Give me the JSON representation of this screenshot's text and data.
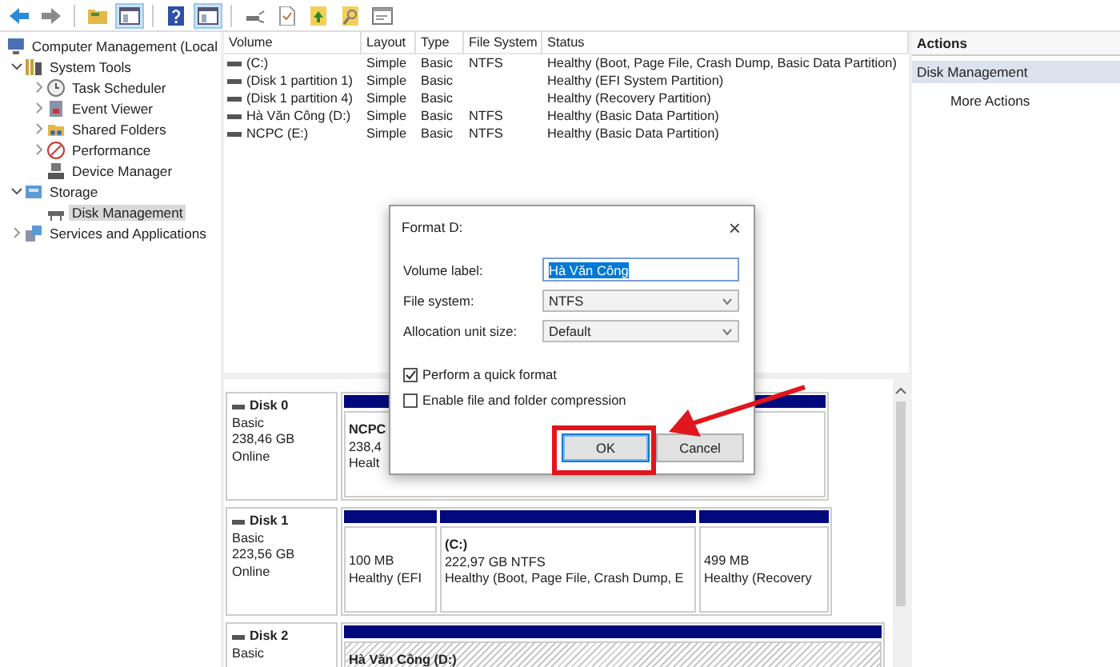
{
  "toolbar": {
    "buttons": [
      {
        "kind": "back",
        "pressed": false
      },
      {
        "kind": "forward",
        "pressed": false
      },
      {
        "kind": "folder",
        "pressed": false
      },
      {
        "kind": "panel",
        "pressed": true
      },
      {
        "kind": "help",
        "pressed": false
      },
      {
        "kind": "panel",
        "pressed": true
      },
      {
        "kind": "plug",
        "pressed": false
      },
      {
        "kind": "page",
        "pressed": false
      },
      {
        "kind": "folder-up",
        "pressed": false
      },
      {
        "kind": "folder-search",
        "pressed": false
      },
      {
        "kind": "window",
        "pressed": false
      }
    ]
  },
  "tree": {
    "items": [
      {
        "label": "Computer Management (Local",
        "selected": false,
        "children": [
          {
            "label": "System Tools",
            "kind": "branch",
            "expanded": true,
            "selected": false,
            "children": [
              {
                "label": "Task Scheduler",
                "kind": "branch",
                "expanded": false,
                "selected": false
              },
              {
                "label": "Event Viewer",
                "kind": "branch",
                "expanded": false,
                "selected": false
              },
              {
                "label": "Shared Folders",
                "kind": "branch",
                "expanded": false,
                "selected": false
              },
              {
                "label": "Performance",
                "kind": "branch",
                "expanded": false,
                "selected": false
              },
              {
                "label": "Device Manager",
                "kind": "leaf",
                "selected": false
              }
            ]
          },
          {
            "label": "Storage",
            "kind": "branch",
            "expanded": true,
            "selected": false,
            "children": [
              {
                "label": "Disk Management",
                "kind": "leaf",
                "selected": true
              }
            ]
          },
          {
            "label": "Services and Applications",
            "kind": "branch",
            "expanded": false,
            "selected": false
          }
        ]
      }
    ]
  },
  "volume_table": {
    "columns": [
      "Volume",
      "Layout",
      "Type",
      "File System",
      "Status"
    ],
    "rows": [
      {
        "volume": "(C:)",
        "layout": "Simple",
        "type": "Basic",
        "file_system": "NTFS",
        "status": "Healthy (Boot, Page File, Crash Dump, Basic Data Partition)"
      },
      {
        "volume": "(Disk 1 partition 1)",
        "layout": "Simple",
        "type": "Basic",
        "status": "Healthy (EFI System Partition)"
      },
      {
        "volume": "(Disk 1 partition 4)",
        "layout": "Simple",
        "type": "Basic",
        "status": "Healthy (Recovery Partition)"
      },
      {
        "volume": "Hà Văn Công (D:)",
        "layout": "Simple",
        "type": "Basic",
        "file_system": "NTFS",
        "status": "Healthy (Basic Data Partition)"
      },
      {
        "volume": "NCPC (E:)",
        "layout": "Simple",
        "type": "Basic",
        "file_system": "NTFS",
        "status": "Healthy (Basic Data Partition)"
      }
    ]
  },
  "disk_map": {
    "disks": [
      {
        "name": "Disk 0",
        "type": "Basic",
        "size": "238,46 GB",
        "status": "Online",
        "partitions": [
          {
            "name": "NCPC",
            "size": "238,4",
            "health": "Healt",
            "selected": false
          }
        ]
      },
      {
        "name": "Disk 1",
        "type": "Basic",
        "size": "223,56 GB",
        "status": "Online",
        "partitions": [
          {
            "size": "100 MB",
            "health": "Healthy (EFI",
            "selected": false
          },
          {
            "name": "(C:)",
            "size": "222,97 GB NTFS",
            "health": "Healthy (Boot, Page File, Crash Dump, E",
            "selected": false
          },
          {
            "size": "499 MB",
            "health": "Healthy (Recovery",
            "selected": false
          }
        ]
      },
      {
        "name": "Disk 2",
        "type": "Basic",
        "partitions": [
          {
            "name": "Hà Văn Công  (D:)",
            "selected": true
          }
        ]
      }
    ]
  },
  "actions": {
    "title": "Actions",
    "items": [
      {
        "label": "Disk Management",
        "kind": "section",
        "selected": true
      },
      {
        "label": "More Actions",
        "kind": "action",
        "selected": false
      }
    ]
  },
  "dialog": {
    "title": "Format D:",
    "close": "×",
    "fields": [
      {
        "label": "Volume label:",
        "kind": "text",
        "value": "Hà Văn Công",
        "value_selected": true
      },
      {
        "label": "File system:",
        "kind": "dropdown",
        "value": "NTFS"
      },
      {
        "label": "Allocation unit size:",
        "kind": "dropdown",
        "value": "Default"
      }
    ],
    "options": [
      {
        "label": "Perform a quick format",
        "checked": true
      },
      {
        "label": "Enable file and folder compression",
        "checked": false
      }
    ],
    "buttons": [
      {
        "label": "OK",
        "default": true,
        "highlighted": true
      },
      {
        "label": "Cancel",
        "default": false,
        "highlighted": false
      }
    ]
  }
}
